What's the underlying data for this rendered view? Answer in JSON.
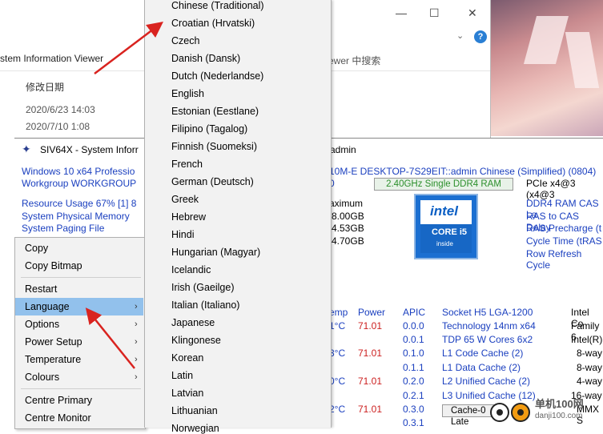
{
  "explorer": {
    "title_fragment": "stem Information Viewer",
    "search_placeholder": "ewer 中搜索",
    "col_date": "修改日期",
    "rows": [
      "2020/6/23 14:03",
      "2020/7/10 1:08"
    ],
    "help": "?"
  },
  "siv": {
    "title": "SIV64X - System Inforr",
    "title_admin": "admin",
    "left_lines": [
      "Windows 10 x64 Professio",
      "Workgroup WORKGROUP",
      "Resource Usage 67% [1] 8",
      "System Physical Memory",
      "System Paging File"
    ],
    "header_line": "10M-E  DESKTOP-7S29EIT::admin  Chinese (Simplified) (0804)",
    "zero": "0",
    "green_box": "2.40GHz Single DDR4 RAM",
    "pcie": "PCIe x4@3 (x4@3",
    "maximum": "aximum",
    "mem_vals": [
      "8.00GB",
      "4.53GB",
      "4.70GB"
    ],
    "ram_info": [
      "DDR4 RAM CAS La",
      "RAS to CAS Delay",
      "RAS Precharge (t",
      "Cycle Time (tRAS",
      "Row Refresh Cycle"
    ],
    "intel": {
      "word": "intel",
      "core": "CORE i5",
      "inside": "inside"
    },
    "temp_header": "emp",
    "power_header": "Power",
    "apic_header": "APIC",
    "temps": [
      "1°C",
      "3°C",
      "0°C",
      "2°C"
    ],
    "powers": [
      "71.01",
      "71.01",
      "71.01",
      "71.01"
    ],
    "apics": [
      "0.0.0",
      "0.0.1",
      "0.1.0",
      "0.1.1",
      "0.2.0",
      "0.2.1",
      "0.3.0",
      "0.3.1"
    ],
    "cpu_info": [
      "Socket H5 LGA-1200",
      "Technology 14nm  x64",
      "TDP 65 W Cores 6x2",
      "L1 Code Cache (2)",
      "L1 Data Cache (2)",
      "L2 Unified Cache (2)",
      "L3 Unified Cache (12)"
    ],
    "right_col": [
      "Intel Co",
      "Family 6",
      "Intel(R)",
      "8-way",
      "8-way",
      "4-way",
      "16-way",
      "MMX S"
    ],
    "cache_box": "Cache-0 Late"
  },
  "context_menu": {
    "items": [
      "Copy",
      "Copy Bitmap",
      "Restart",
      "Language",
      "Options",
      "Power Setup",
      "Temperature",
      "Colours",
      "Centre Primary",
      "Centre Monitor"
    ]
  },
  "language_menu": {
    "items": [
      "Chinese (Traditional)",
      "Croatian (Hrvatski)",
      "Czech",
      "Danish (Dansk)",
      "Dutch (Nederlandse)",
      "English",
      "Estonian (Eestlane)",
      "Filipino (Tagalog)",
      "Finnish (Suomeksi)",
      "French",
      "German (Deutsch)",
      "Greek",
      "Hebrew",
      "Hindi",
      "Hungarian (Magyar)",
      "Icelandic",
      "Irish (Gaeilge)",
      "Italian (Italiano)",
      "Japanese",
      "Klingonese",
      "Korean",
      "Latin",
      "Latvian",
      "Lithuanian",
      "Norwegian"
    ]
  },
  "watermark": {
    "text": "单机100网",
    "url": "danji100.com"
  },
  "colors": {
    "highlight": "#92c1ec",
    "link_blue": "#1a3fbf",
    "value_red": "#cc1f1f",
    "green": "#2b8f2b",
    "arrow_red": "#d9231f"
  }
}
